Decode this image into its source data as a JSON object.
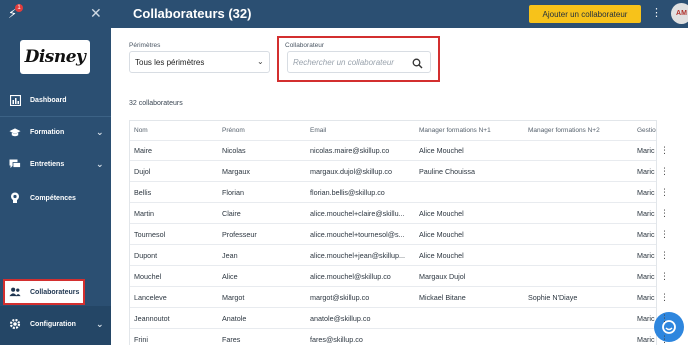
{
  "sidebar": {
    "notification_count": "1",
    "logo_text": "Disney",
    "items": [
      {
        "label": "Dashboard",
        "icon": "chart-icon"
      },
      {
        "label": "Formation",
        "icon": "graduation-cap-icon",
        "has_chevron": true
      },
      {
        "label": "Entretiens",
        "icon": "chat-icon",
        "has_chevron": true
      },
      {
        "label": "Compétences",
        "icon": "lightbulb-icon"
      },
      {
        "label": "Collaborateurs",
        "icon": "users-icon",
        "active": true
      },
      {
        "label": "Configuration",
        "icon": "gear-icon",
        "has_chevron": true
      }
    ]
  },
  "header": {
    "title": "Collaborateurs (32)",
    "add_button": "Ajouter un collaborateur",
    "avatar_initials": "AM"
  },
  "filters": {
    "perimeters_label": "Périmètres",
    "perimeters_value": "Tous les périmètres",
    "collaborator_label": "Collaborateur",
    "search_placeholder": "Rechercher un collaborateur"
  },
  "count_text": "32 collaborateurs",
  "table": {
    "columns": [
      "Nom",
      "Prénom",
      "Email",
      "Manager formations N+1",
      "Manager formations N+2",
      "Gestio"
    ],
    "rows": [
      [
        "Maire",
        "Nicolas",
        "nicolas.maire@skillup.co",
        "Alice Mouchel",
        "",
        "Maric"
      ],
      [
        "Dujol",
        "Margaux",
        "margaux.dujol@skillup.co",
        "Pauline Chouissa",
        "",
        "Maric"
      ],
      [
        "Bellis",
        "Florian",
        "florian.bellis@skillup.co",
        "",
        "",
        "Maric"
      ],
      [
        "Martin",
        "Claire",
        "alice.mouchel+claire@skillu...",
        "Alice Mouchel",
        "",
        "Maric"
      ],
      [
        "Tournesol",
        "Professeur",
        "alice.mouchel+tournesol@s...",
        "Alice Mouchel",
        "",
        "Maric"
      ],
      [
        "Dupont",
        "Jean",
        "alice.mouchel+jean@skillup...",
        "Alice Mouchel",
        "",
        "Maric"
      ],
      [
        "Mouchel",
        "Alice",
        "alice.mouchel@skillup.co",
        "Margaux Dujol",
        "",
        "Maric"
      ],
      [
        "Lanceleve",
        "Margot",
        "margot@skillup.co",
        "Mickael Bitane",
        "Sophie N'Diaye",
        "Maric"
      ],
      [
        "Jeannoutot",
        "Anatole",
        "anatole@skillup.co",
        "",
        "",
        "Maric"
      ],
      [
        "Frini",
        "Fares",
        "fares@skillup.co",
        "",
        "",
        "Maric"
      ]
    ]
  },
  "colors": {
    "sidebar": "#2b4f72",
    "accent_button": "#f7c21a",
    "highlight": "#d32f2f",
    "help_button": "#2e86de"
  }
}
